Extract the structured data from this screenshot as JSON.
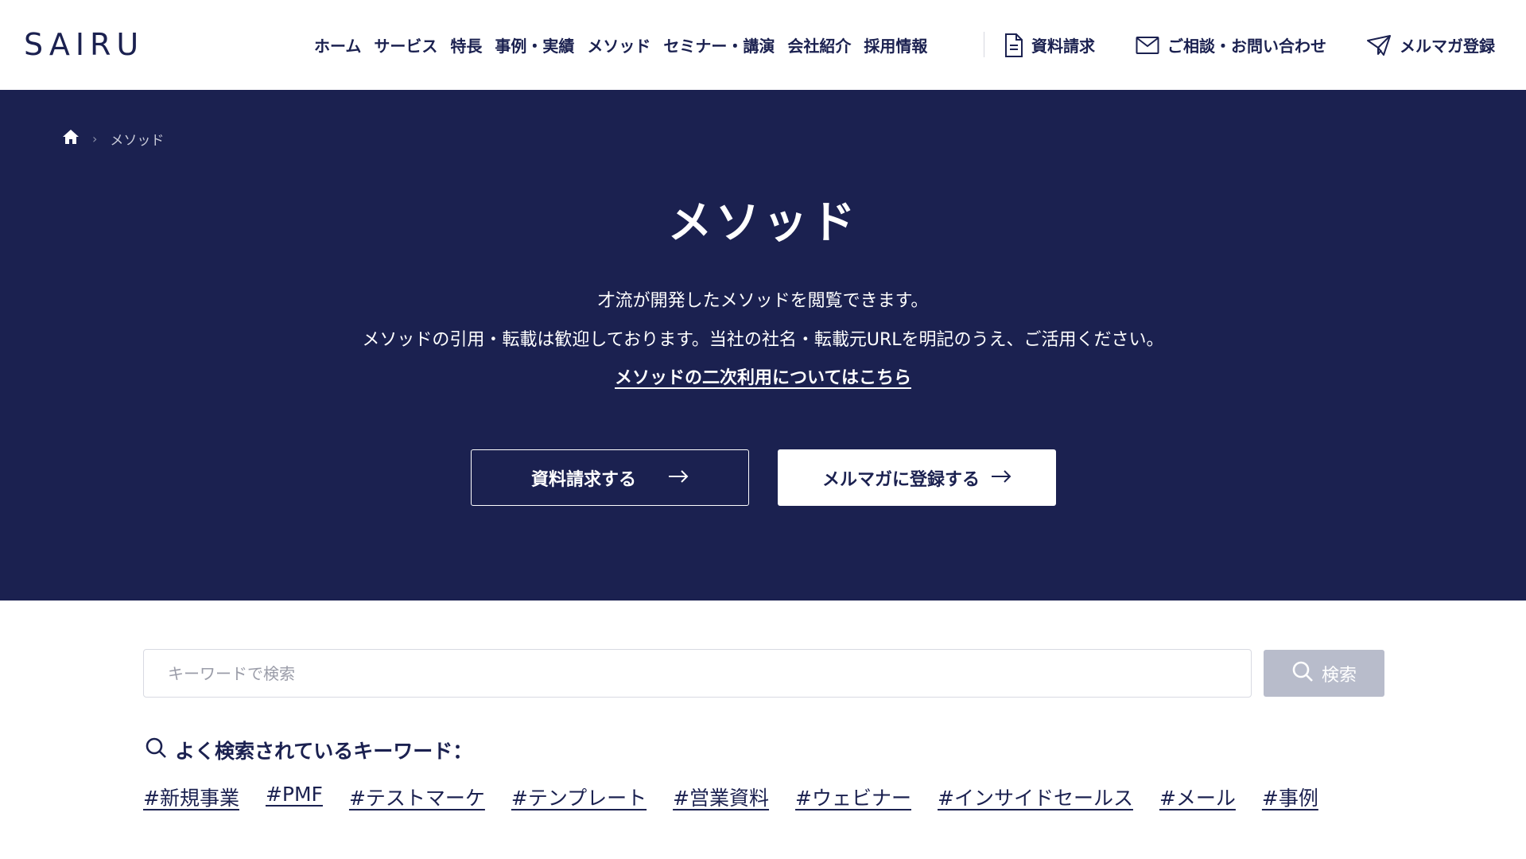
{
  "brand": {
    "logo": "SAIRU"
  },
  "nav": {
    "items": [
      {
        "label": "ホーム"
      },
      {
        "label": "サービス"
      },
      {
        "label": "特長"
      },
      {
        "label": "事例・実績"
      },
      {
        "label": "メソッド",
        "active": true
      },
      {
        "label": "セミナー・講演"
      },
      {
        "label": "会社紹介"
      },
      {
        "label": "採用情報"
      }
    ],
    "utility": [
      {
        "label": "資料請求",
        "icon": "document-icon"
      },
      {
        "label": "ご相談・お問い合わせ",
        "icon": "mail-icon"
      },
      {
        "label": "メルマガ登録",
        "icon": "paper-plane-icon"
      }
    ]
  },
  "breadcrumb": {
    "home_icon": "home-icon",
    "current": "メソッド"
  },
  "hero": {
    "title": "メソッド",
    "desc_line1": "才流が開発したメソッドを閲覧できます。",
    "desc_line2": "メソッドの引用・転載は歓迎しております。当社の社名・転載元URLを明記のうえ、ご活用ください。",
    "link": "メソッドの二次利用についてはこちら",
    "button_primary": "資料請求する",
    "button_secondary": "メルマガに登録する"
  },
  "search": {
    "placeholder": "キーワードで検索",
    "button_label": "検索",
    "popular_heading": "よく検索されているキーワード：",
    "tags": [
      "#新規事業",
      "#PMF",
      "#テストマーケ",
      "#テンプレート",
      "#営業資料",
      "#ウェビナー",
      "#インサイドセールス",
      "#メール",
      "#事例"
    ]
  },
  "colors": {
    "navy": "#1b2150",
    "search_button": "#b8bccb"
  }
}
